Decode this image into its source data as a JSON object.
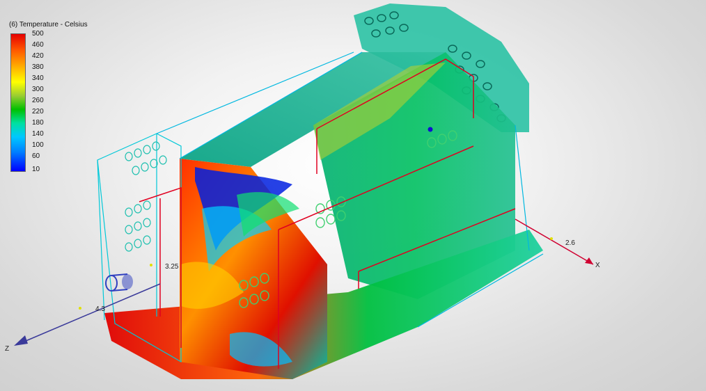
{
  "legend": {
    "title": "(6) Temperature - Celsius",
    "ticks": [
      "500",
      "460",
      "420",
      "380",
      "340",
      "300",
      "260",
      "220",
      "180",
      "140",
      "100",
      "60",
      "10"
    ]
  },
  "axes": {
    "x_label": "X",
    "z_label": "Z",
    "dim_x": "2.6",
    "dim_z": "4.3",
    "dim_mid": "3.25"
  },
  "colors": {
    "hot": "#e60000",
    "warm": "#ffb000",
    "mid": "#00c000",
    "cool": "#00e0a0",
    "cold": "#0000ff",
    "axis_x": "#d00030",
    "axis_z": "#3a3a9a",
    "edge": "#00c8d8"
  }
}
